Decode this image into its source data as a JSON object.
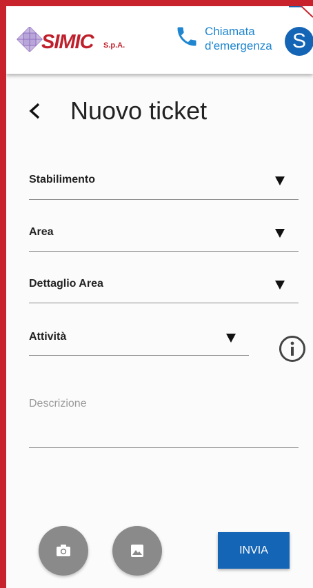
{
  "header": {
    "brand": "SIMIC",
    "brand_suffix": "S.p.A.",
    "emergency_line1": "Chiamata",
    "emergency_line2": "d'emergenza",
    "avatar_initial": "S"
  },
  "page": {
    "title": "Nuovo ticket"
  },
  "form": {
    "stabilimento_label": "Stabilimento",
    "area_label": "Area",
    "dettaglio_label": "Dettaglio Area",
    "attivita_label": "Attività",
    "descrizione_placeholder": "Descrizione"
  },
  "actions": {
    "send_label": "INVIA"
  },
  "colors": {
    "frame": "#c8232c",
    "brand_red": "#c0202b",
    "accent_blue": "#1565b6",
    "link_blue": "#1f86cf",
    "fab_gray": "#8a8a8a"
  },
  "icons": [
    "logo-diamond-icon",
    "phone-icon",
    "back-arrow-icon",
    "dropdown-arrow-icon",
    "info-icon",
    "camera-icon",
    "image-icon"
  ]
}
